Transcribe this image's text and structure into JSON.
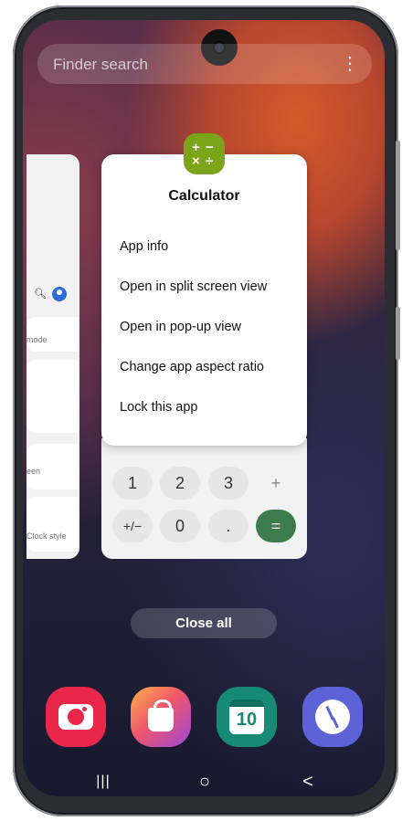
{
  "search": {
    "placeholder": "Finder search",
    "more_glyph": "⋮"
  },
  "recents": {
    "left_card": {
      "item1": "mode",
      "item2": "een",
      "item3": "Clock style"
    },
    "popup": {
      "title": "Calculator",
      "menu": [
        "App info",
        "Open in split screen view",
        "Open in pop-up view",
        "Change app aspect ratio",
        "Lock this app"
      ]
    },
    "calc_keys": [
      "1",
      "2",
      "3",
      "+",
      "+/−",
      "0",
      ".",
      "="
    ],
    "close_all_label": "Close all"
  },
  "dock": [
    {
      "icon": "camera-icon",
      "color": "#e8274b"
    },
    {
      "icon": "galaxy-store-icon",
      "color": "#f0566b"
    },
    {
      "icon": "calendar-icon",
      "label": "10",
      "color": "#178a76"
    },
    {
      "icon": "clock-icon",
      "color": "#5b63d6"
    }
  ],
  "navbar": {
    "recents": "|||",
    "home": "○",
    "back": "<"
  }
}
